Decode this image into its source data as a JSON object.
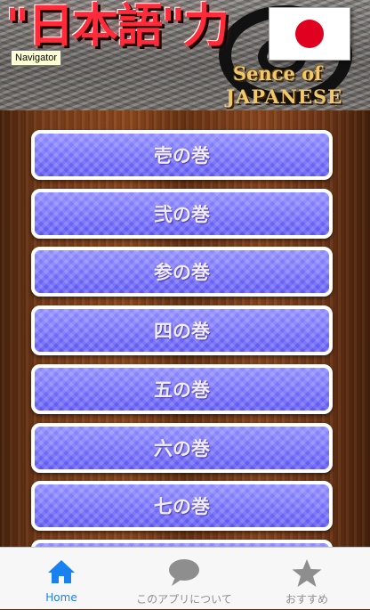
{
  "banner": {
    "title": "\"日本語\"力",
    "subtitle_line1": "Sence of",
    "subtitle_line2": "JAPANESE",
    "tooltip": "Navigator"
  },
  "menu": {
    "items": [
      {
        "label": "壱の巻"
      },
      {
        "label": "弐の巻"
      },
      {
        "label": "参の巻"
      },
      {
        "label": "四の巻"
      },
      {
        "label": "五の巻"
      },
      {
        "label": "六の巻"
      },
      {
        "label": "七の巻"
      },
      {
        "label": ""
      }
    ]
  },
  "tabbar": {
    "tabs": [
      {
        "label": "Home",
        "icon": "home-icon",
        "active": true
      },
      {
        "label": "このアプリについて",
        "icon": "speech-bubble-icon",
        "active": false
      },
      {
        "label": "おすすめ",
        "icon": "star-icon",
        "active": false
      }
    ]
  },
  "colors": {
    "active_tab": "#1a82f0",
    "inactive_tab": "#8e8e8e",
    "button_top": "#8f8bff",
    "button_bottom": "#5d56f2",
    "banner_title": "#ff2a3a",
    "banner_subtitle": "#f1c96a"
  }
}
